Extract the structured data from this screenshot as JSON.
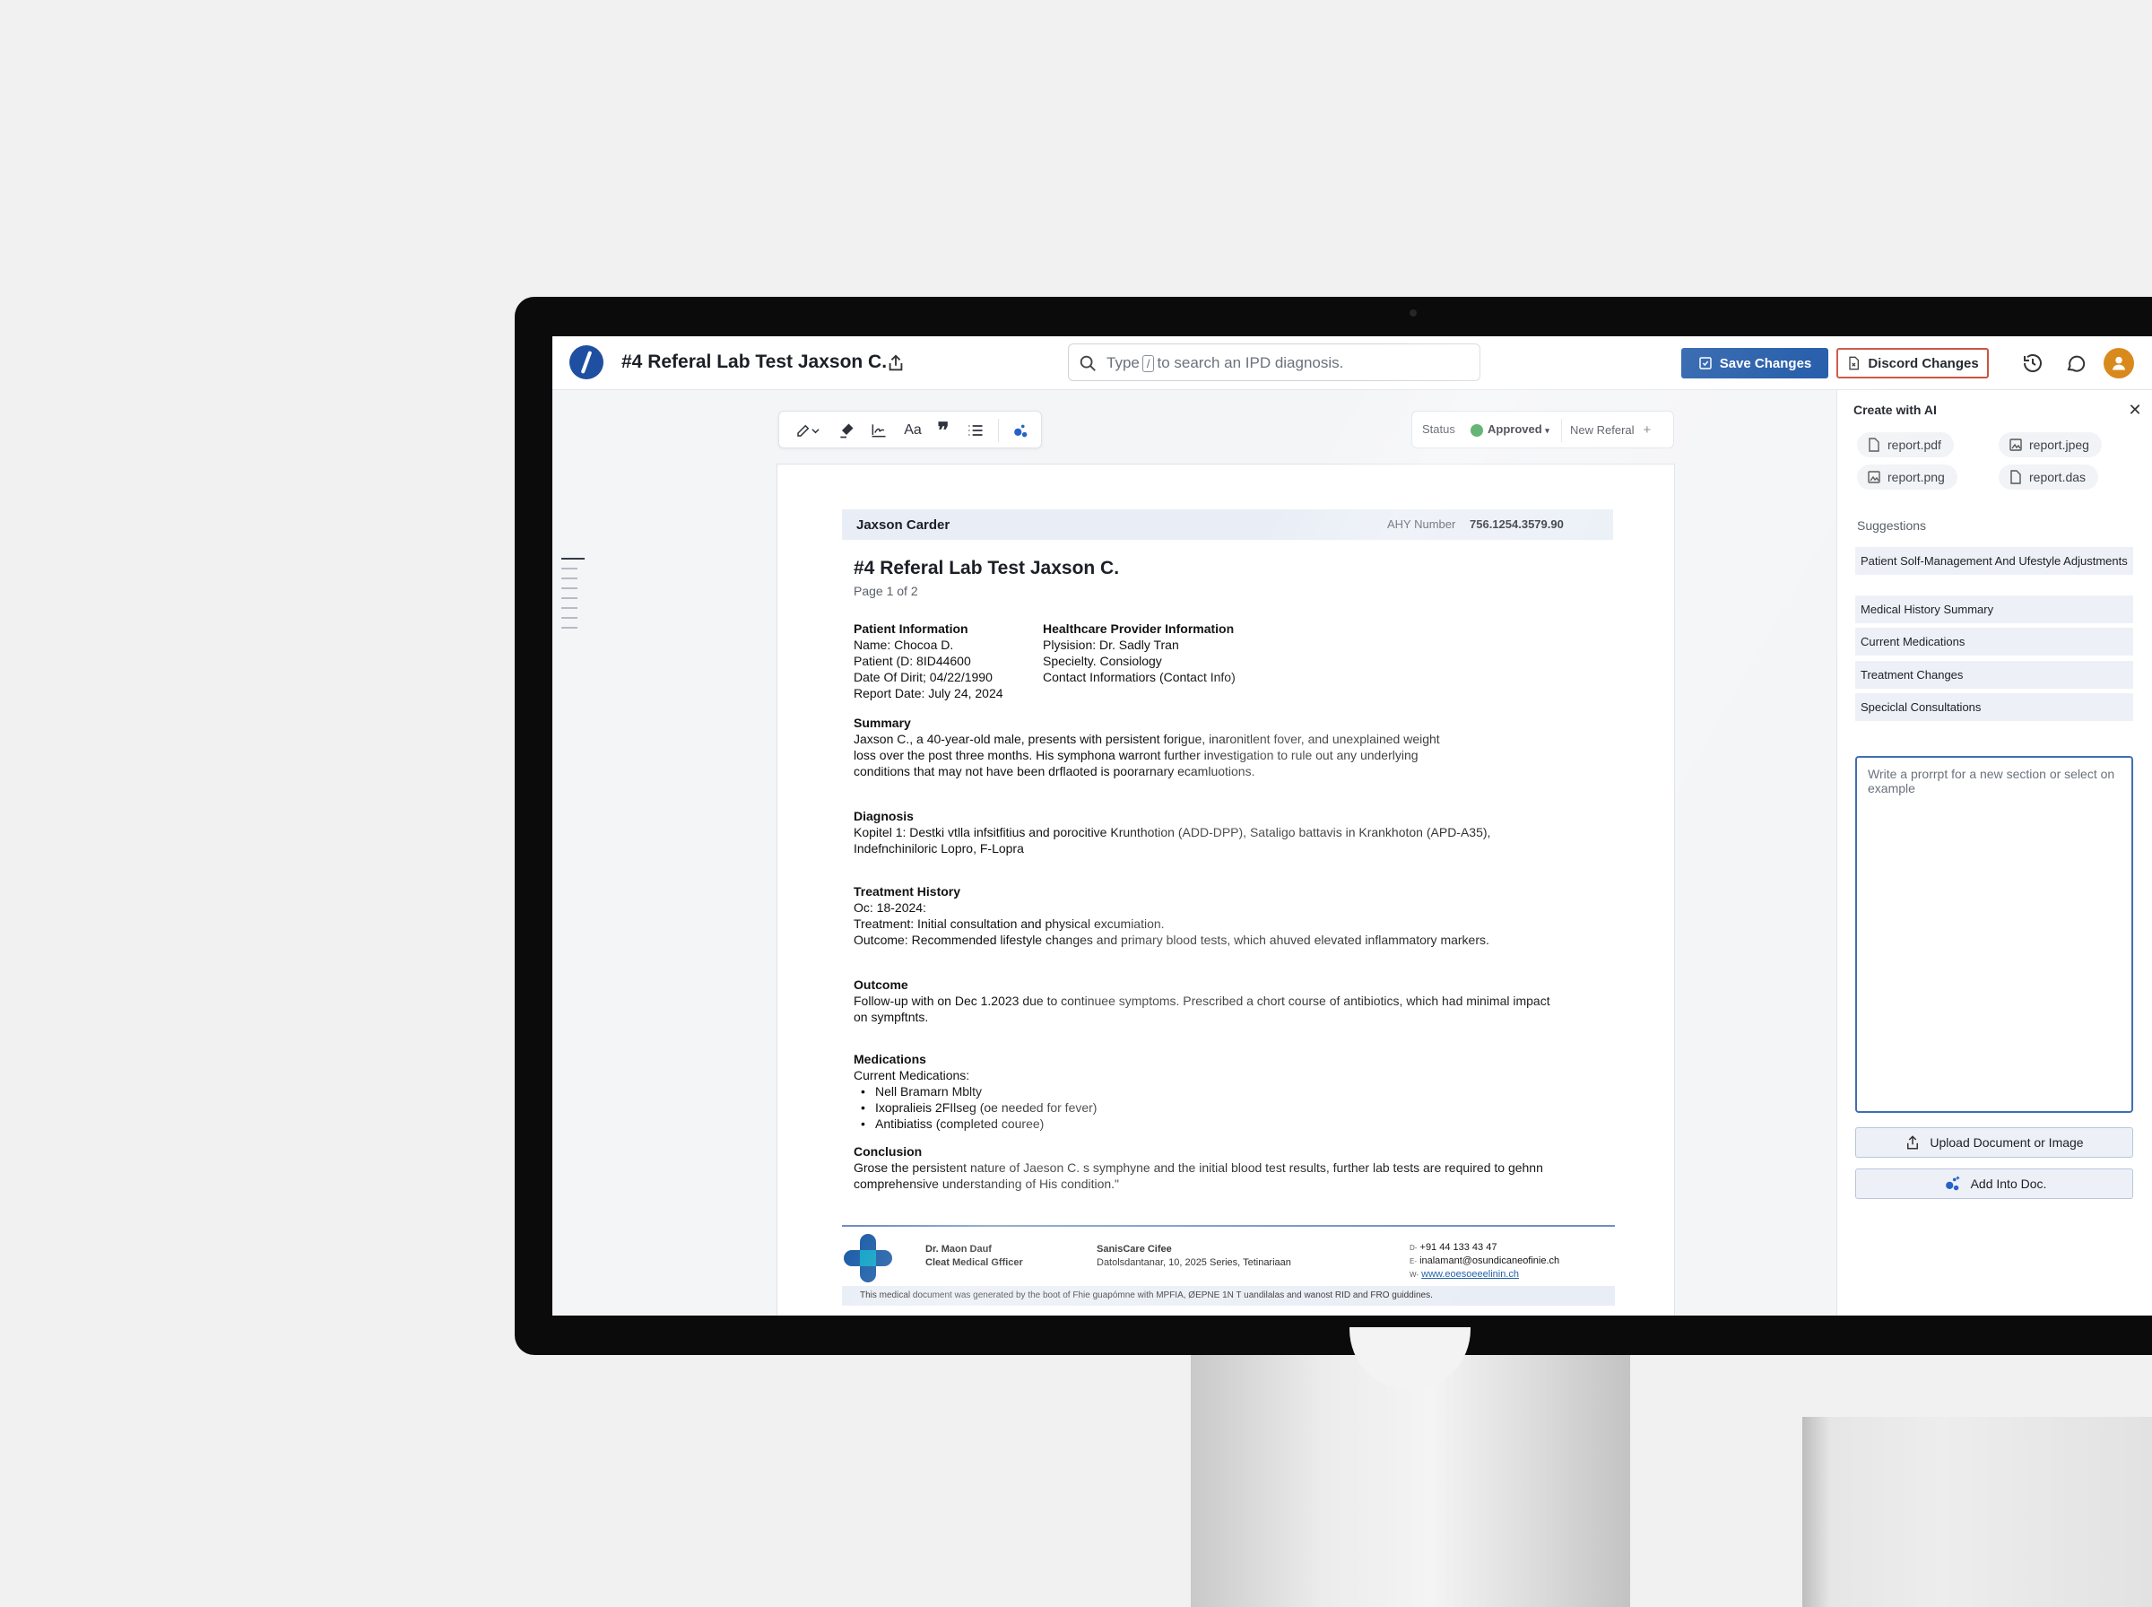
{
  "topbar": {
    "title": "#4 Referal Lab Test Jaxson C.",
    "search_prefix": "Type",
    "search_key": "/",
    "search_suffix": "to search an IPD diagnosis.",
    "save_label": "Save Changes",
    "discard_label": "Discord Changes"
  },
  "toolbar": {
    "font_label": "Aa",
    "quote_label": "❞"
  },
  "status": {
    "label": "Status",
    "value": "Approved",
    "new_referral": "New Referal"
  },
  "document": {
    "patient_name": "Jaxson Carder",
    "ahy_label": "AHY Number",
    "ahy_value": "756.1254.3579.90",
    "title": "#4 Referal Lab Test Jaxson C.",
    "page_label": "Page 1 of 2",
    "patient_info": {
      "heading": "Patient Information",
      "lines": [
        "Name: Chocoa D.",
        "Patient (D: 8ID44600",
        "Date Of Dirit; 04/22/1990",
        "Report Date: July 24, 2024"
      ]
    },
    "provider_info": {
      "heading": "Healthcare Provider Information",
      "lines": [
        "Plysision: Dr. Sadly Tran",
        "Specielty. Consiology",
        "Contact Informatiors (Contact Info)"
      ]
    },
    "summary": {
      "heading": "Summary",
      "lines": [
        "Jaxson C., a 40-year-old male, presents with persistent forigue, inaronitlent fover, and unexplained weight",
        "loss over the post three months. His symphona warront further investigation to rule out any underlying",
        "conditions that may not have been drflaoted is poorarnary ecamluotions."
      ]
    },
    "diagnosis": {
      "heading": "Diagnosis",
      "lines": [
        "Kopitel 1: Destki vtlla infsitfitius and porocitive Krunthotion (ADD-DPP), Sataligo battavis in Krankhoton (APD-A35),",
        "Indefnchiniloric Lopro, F-Lopra"
      ]
    },
    "treatment": {
      "heading": "Treatment History",
      "lines": [
        "Oc: 18-2024:",
        "Treatment: Initial consultation and physical excumiation.",
        "Outcome: Recommended lifestyle changes and primary blood tests, which ahuved elevated inflammatory markers."
      ]
    },
    "outcome": {
      "heading": "Outcome",
      "lines": [
        "Follow-up with on Dec 1.2023 due to continuee symptoms. Prescribed a chort course of antibiotics, which had minimal impact",
        "on sympftnts."
      ]
    },
    "medications": {
      "heading": "Medications",
      "intro": "Current Medications:",
      "items": [
        "Nell Bramarn Mblty",
        "Ixopralieis 2FIlseg (oe needed for fever)",
        "Antibiatiss (completed couree)"
      ]
    },
    "conclusion": {
      "heading": "Conclusion",
      "lines": [
        "Grose the persistent nature of Jaeson C. s symphyne and the initial blood test results, further lab tests are required to gehnn",
        "comprehensive understanding of His condition.\""
      ]
    },
    "footer": {
      "doctor_name": "Dr. Maon Dauf",
      "doctor_role": "Cleat Medical Gfficer",
      "org_name": "SanisCare Cifee",
      "org_address": "Datolsdantanar, 10, 2025 Series, Tetinariaan",
      "phone": "+91 44 133 43 47",
      "email": "inalamant@osundicaneofinie.ch",
      "website": "www.eoesoeeelinin.ch",
      "phone_prefix": "D-",
      "email_prefix": "E-",
      "web_prefix": "W-",
      "disclaimer": "This medical document was generated by the boot of Fhie guapómne with MPFIA, ØEPNE 1N T uandilalas and wanost RID and FRO guiddines."
    }
  },
  "panel": {
    "title": "Create with AI",
    "files": [
      "report.pdf",
      "report.jpeg",
      "report.png",
      "report.das"
    ],
    "suggestions_label": "Suggestions",
    "suggestions": [
      "Patient Solf-Management And Ufestyle Adjustments",
      "Medical History Summary",
      "Current Medications",
      "Treatment Changes",
      "Speciclal Consultations"
    ],
    "prompt_placeholder": "Write a prorrpt for a new section or select on example",
    "upload_label": "Upload Document or Image",
    "add_label": "Add Into Doc."
  },
  "colors": {
    "primary": "#1450a3",
    "discard_border": "#c94f3b",
    "approved": "#2f9b45",
    "avatar": "#d98a1d"
  }
}
